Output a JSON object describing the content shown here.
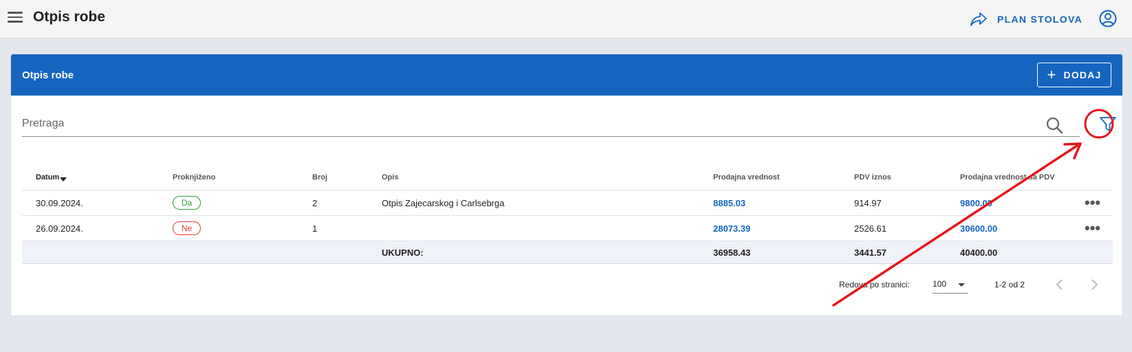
{
  "appbar": {
    "title": "Otpis robe",
    "plan_label": "PLAN STOLOVA",
    "icons": {
      "menu": "menu-icon",
      "plan": "forward-arrow-icon",
      "account": "account-circle-icon"
    }
  },
  "card": {
    "title": "Otpis robe",
    "add_label": "DODAJ"
  },
  "search": {
    "placeholder": "Pretraga",
    "value": ""
  },
  "table": {
    "columns": [
      "Datum",
      "Proknjiženo",
      "Broj",
      "Opis",
      "Prodajna vrednost",
      "PDV iznos",
      "Prodajna vrednost sa PDV"
    ],
    "rows": [
      {
        "datum": "30.09.2024.",
        "proknjizeno": "Da",
        "broj": "2",
        "opis": "Otpis Zajecarskog i Carlsebrga",
        "prodajna": "8885.03",
        "pdv": "914.97",
        "sa_pdv": "9800.00"
      },
      {
        "datum": "26.09.2024.",
        "proknjizeno": "Ne",
        "broj": "1",
        "opis": "",
        "prodajna": "28073.39",
        "pdv": "2526.61",
        "sa_pdv": "30600.00"
      }
    ],
    "total": {
      "label": "UKUPNO:",
      "prodajna": "36958.43",
      "pdv": "3441.57",
      "sa_pdv": "40400.00"
    }
  },
  "pagination": {
    "rows_per_page_label": "Redova po stranici:",
    "rows_per_page_value": "100",
    "range": "1-2 od 2"
  },
  "colors": {
    "primary": "#1565c0",
    "posted_yes": "#2e9c3a",
    "posted_no": "#e53935",
    "annotation": "#e8141c"
  }
}
